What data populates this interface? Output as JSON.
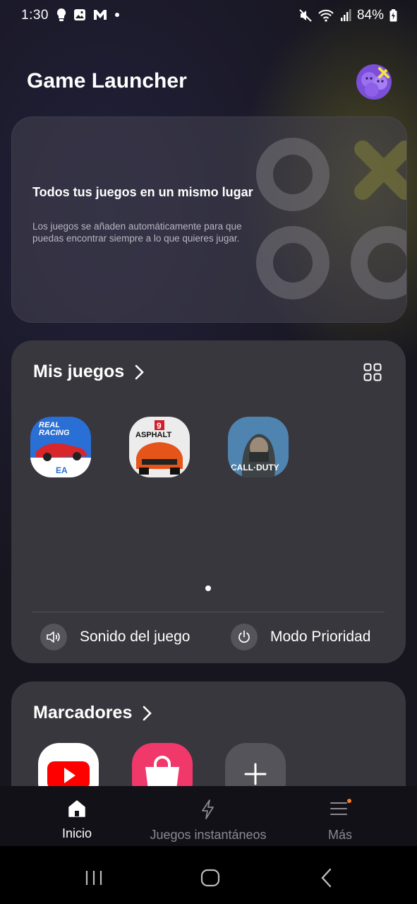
{
  "status_bar": {
    "time": "1:30",
    "battery": "84%"
  },
  "header": {
    "title": "Game Launcher"
  },
  "banner": {
    "heading": "Todos tus juegos en un mismo lugar",
    "body": "Los juegos se añaden automáticamente para que puedas encontrar siempre a lo que quieres jugar."
  },
  "my_games": {
    "title": "Mis juegos",
    "games": [
      {
        "name": "Real Racing",
        "icon": "real-racing-icon",
        "label_top": "REAL",
        "label_bottom": "RACING",
        "brand": "EA"
      },
      {
        "name": "Asphalt 9",
        "icon": "asphalt-icon",
        "number": "9",
        "label": "ASPHALT"
      },
      {
        "name": "Call of Duty",
        "icon": "call-of-duty-icon",
        "label": "CALL·DUTY"
      }
    ],
    "options": [
      {
        "label": "Sonido del juego",
        "icon": "speaker-icon"
      },
      {
        "label": "Modo Prioridad",
        "icon": "power-icon"
      }
    ]
  },
  "bookmarks": {
    "title": "Marcadores"
  },
  "bottom_nav": {
    "items": [
      {
        "label": "Inicio",
        "icon": "home-icon"
      },
      {
        "label": "Juegos instantáneos",
        "icon": "bolt-icon"
      },
      {
        "label": "Más",
        "icon": "menu-icon"
      }
    ]
  },
  "colors": {
    "accent_orange": "#ff7a1a",
    "card": "#38373d",
    "youtube_red": "#ff0000",
    "store_pink": "#f0386b"
  }
}
